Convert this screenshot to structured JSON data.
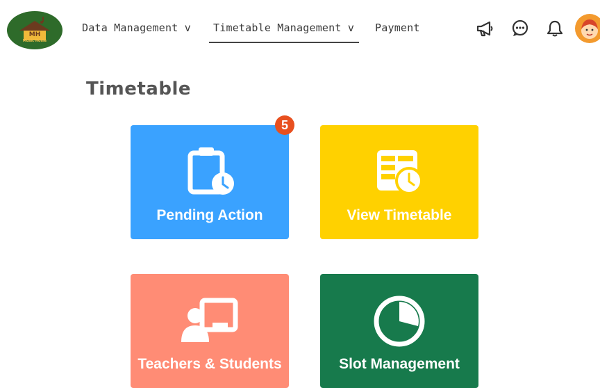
{
  "brand": {
    "logo_text": "MH",
    "logo_subtext": "Music Home"
  },
  "nav": {
    "items": [
      {
        "label": "Data Management v"
      },
      {
        "label": "Timetable Management v",
        "active": true
      },
      {
        "label": "Payment"
      }
    ]
  },
  "header_icons": [
    "megaphone-icon",
    "chat-icon",
    "bell-icon",
    "user-avatar"
  ],
  "page": {
    "title": "Timetable"
  },
  "cards": [
    {
      "label": "Pending Action",
      "badge": "5",
      "color": "#3aa2ff",
      "icon": "clipboard-clock-icon"
    },
    {
      "label": "View Timetable",
      "color": "#ffd100",
      "icon": "timetable-clock-icon"
    },
    {
      "label": "Teachers & Students",
      "color": "#ff8c75",
      "icon": "teacher-board-icon"
    },
    {
      "label": "Slot Management",
      "color": "#177a4c",
      "icon": "pie-slot-icon"
    }
  ]
}
